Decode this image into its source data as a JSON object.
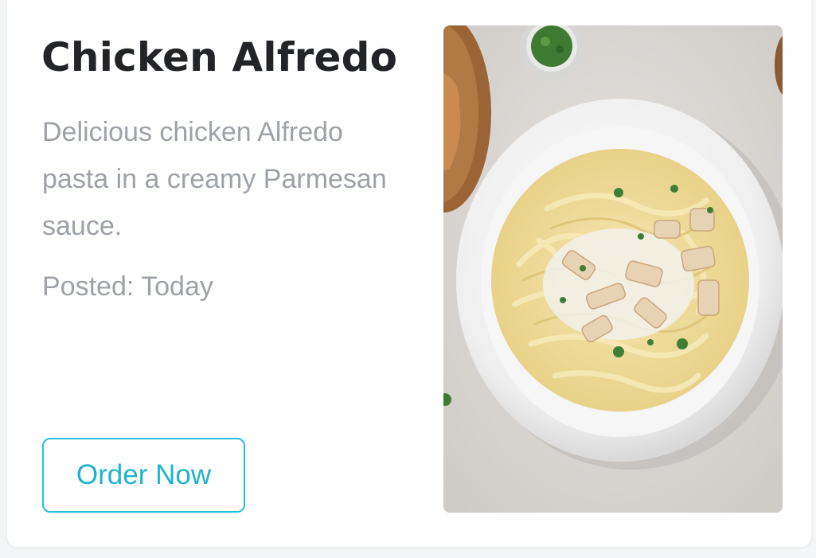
{
  "card": {
    "title": "Chicken Alfredo",
    "description": "Delicious chicken Alfredo pasta in a creamy Parmesan sauce.",
    "posted": "Posted: Today",
    "order_button_label": "Order Now",
    "image": {
      "icon": "food-photo-icon",
      "subject": "chicken-alfredo-pasta-plate"
    }
  },
  "colors": {
    "accent": "#27bfd8",
    "title_text": "#232427",
    "muted_text": "#9ea2a8"
  }
}
